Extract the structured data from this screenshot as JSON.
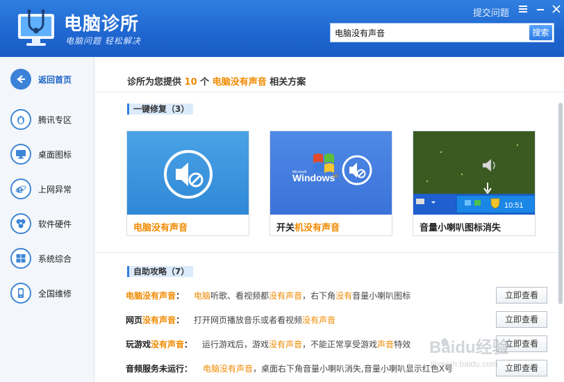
{
  "header": {
    "title": "电脑诊所",
    "slogan": "电脑问题 轻松解决",
    "feedback_link": "提交问题",
    "menu_icon": "menu-icon",
    "minimize_icon": "minimize-icon",
    "close_icon": "close-icon"
  },
  "search": {
    "value": "电脑没有声音",
    "button": "搜索"
  },
  "sidebar": {
    "items": [
      {
        "label": "返回首页",
        "icon": "back-arrow-icon"
      },
      {
        "label": "腾讯专区",
        "icon": "penguin-icon"
      },
      {
        "label": "桌面图标",
        "icon": "monitor-icon"
      },
      {
        "label": "上网异常",
        "icon": "ie-icon"
      },
      {
        "label": "软件硬件",
        "icon": "gear-icon"
      },
      {
        "label": "系统综合",
        "icon": "windows-icon"
      },
      {
        "label": "全国维修",
        "icon": "phone-icon"
      }
    ]
  },
  "summary": {
    "prefix": "诊所为您提供",
    "count": "10",
    "mid": "个",
    "keyword": "电脑没有声音",
    "suffix": "相关方案"
  },
  "one_click": {
    "heading": "一键修复（3）",
    "cards": [
      {
        "parts": [
          {
            "t": "电脑没有声音",
            "hl": true
          }
        ]
      },
      {
        "parts": [
          {
            "t": "开关",
            "hl": false
          },
          {
            "t": "机没有声音",
            "hl": true
          }
        ]
      },
      {
        "parts": [
          {
            "t": "音量小喇叭图标消失",
            "hl": false
          }
        ]
      }
    ],
    "windows_text": "Windows",
    "windows_sup": "xp",
    "microsoft_text": "Microsoft",
    "tray_time": "10:51"
  },
  "self_help": {
    "heading": "自助攻略（7）",
    "articles": [
      {
        "title": [
          {
            "t": "电脑没有声音",
            "hl": true
          },
          {
            "t": "：",
            "hl": false
          }
        ],
        "desc": [
          {
            "t": "电脑",
            "hl": true
          },
          {
            "t": "听歌、看视频都",
            "hl": false
          },
          {
            "t": "没有声音",
            "hl": true
          },
          {
            "t": "，右下角",
            "hl": false
          },
          {
            "t": "没有",
            "hl": true
          },
          {
            "t": "音量小喇叭图标",
            "hl": false
          }
        ],
        "button": "立即查看"
      },
      {
        "title": [
          {
            "t": "网页",
            "hl": false
          },
          {
            "t": "没有声音",
            "hl": true
          },
          {
            "t": "：",
            "hl": false
          }
        ],
        "desc": [
          {
            "t": "打开网页播放音乐或者看视频",
            "hl": false
          },
          {
            "t": "没有声音",
            "hl": true
          }
        ],
        "button": "立即查看"
      },
      {
        "title": [
          {
            "t": "玩游戏",
            "hl": false
          },
          {
            "t": "没有声音",
            "hl": true
          },
          {
            "t": "：",
            "hl": false
          }
        ],
        "desc": [
          {
            "t": "运行游戏后，游戏",
            "hl": false
          },
          {
            "t": "没有声音",
            "hl": true
          },
          {
            "t": "，不能正常享受游戏",
            "hl": false
          },
          {
            "t": "声音",
            "hl": true
          },
          {
            "t": "特效",
            "hl": false
          }
        ],
        "button": "立即查看"
      },
      {
        "title": [
          {
            "t": "音频服务未运行",
            "hl": false
          },
          {
            "t": "：",
            "hl": false
          }
        ],
        "desc": [
          {
            "t": "电脑没有声音",
            "hl": true
          },
          {
            "t": "，桌面右下角音量小喇叭消失,音量小喇叭显示红色X号",
            "hl": false
          }
        ],
        "button": "立即查看"
      }
    ]
  },
  "watermark": {
    "text": "Baidu经验",
    "url": "jingyan.baidu.com"
  }
}
